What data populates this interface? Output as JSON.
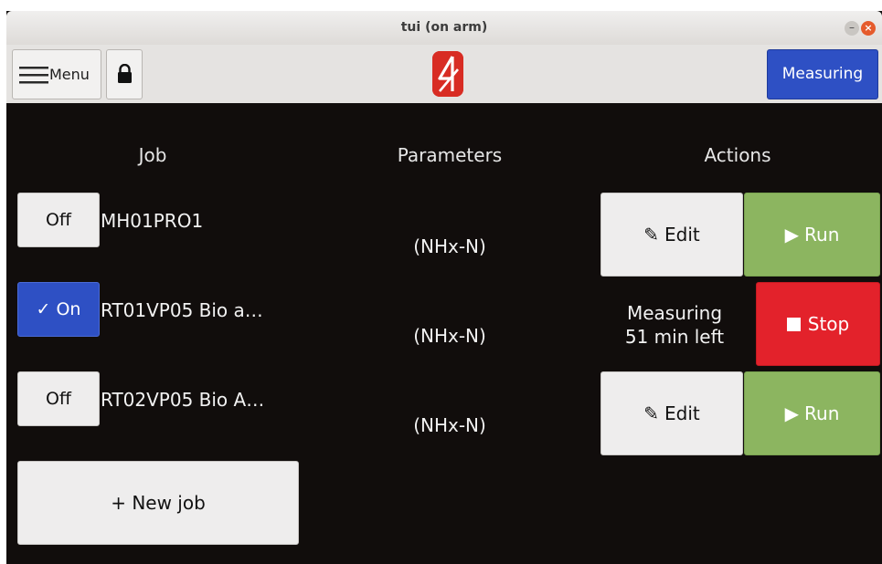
{
  "window": {
    "title": "tui (on arm)",
    "minimize_glyph": "–",
    "close_glyph": "×"
  },
  "toolbar": {
    "menu_label": "Menu",
    "status_button_label": "Measuring",
    "icons": [
      "hamburger-menu-icon",
      "lock-icon",
      "brand-logo-icon"
    ]
  },
  "headers": {
    "job": "Job",
    "parameters": "Parameters",
    "actions": "Actions"
  },
  "jobs": [
    {
      "toggle": "Off",
      "name": "MH01PRO1",
      "parameters": "(NHx-N)",
      "edit_label": "Edit",
      "run_label": "Run"
    },
    {
      "toggle": "✓ On",
      "name": "RT01VP05 Bio a…",
      "parameters": "(NHx-N)",
      "status_line1": "Measuring",
      "status_line2": "51 min left",
      "stop_label": "Stop"
    },
    {
      "toggle": "Off",
      "name": "RT02VP05 Bio A…",
      "parameters": "(NHx-N)",
      "edit_label": "Edit",
      "run_label": "Run"
    }
  ],
  "new_job_label": "+ New job",
  "colors": {
    "background": "#110d0c",
    "accent_blue": "#2e50c4",
    "run_green": "#8cb560",
    "stop_red": "#e3222b",
    "logo_red": "#d82c23"
  }
}
